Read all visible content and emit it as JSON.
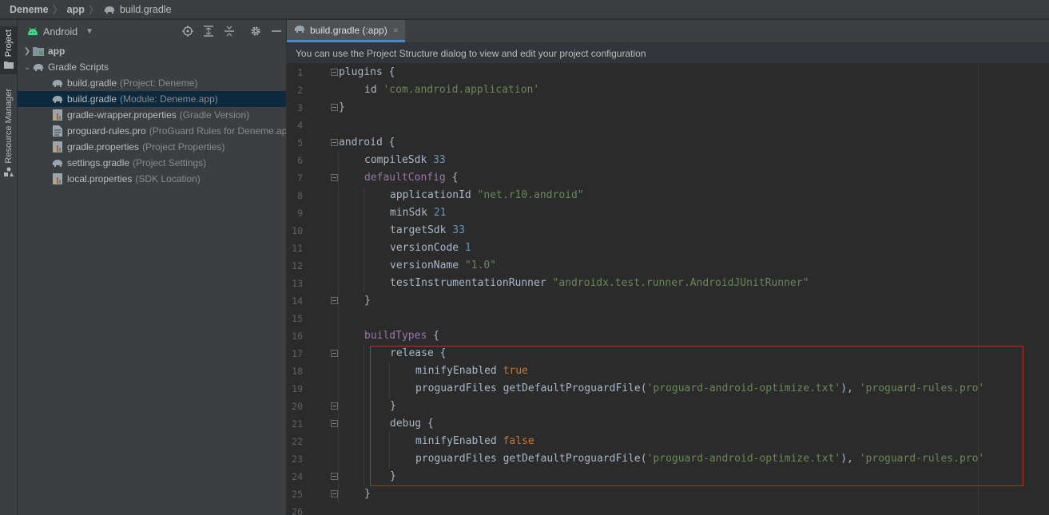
{
  "breadcrumb": {
    "items": [
      "Deneme",
      "app",
      "build.gradle"
    ],
    "separator": "〉"
  },
  "tool_strip": {
    "project": "Project",
    "resource_manager": "Resource Manager"
  },
  "project_panel": {
    "view_mode": "Android",
    "tree": [
      {
        "label": "app",
        "desc": ""
      },
      {
        "label": "Gradle Scripts",
        "desc": ""
      },
      {
        "label": "build.gradle",
        "desc": "(Project: Deneme)"
      },
      {
        "label": "build.gradle",
        "desc": "(Module: Deneme.app)"
      },
      {
        "label": "gradle-wrapper.properties",
        "desc": "(Gradle Version)"
      },
      {
        "label": "proguard-rules.pro",
        "desc": "(ProGuard Rules for Deneme.app)"
      },
      {
        "label": "gradle.properties",
        "desc": "(Project Properties)"
      },
      {
        "label": "settings.gradle",
        "desc": "(Project Settings)"
      },
      {
        "label": "local.properties",
        "desc": "(SDK Location)"
      }
    ]
  },
  "editor": {
    "tab_label": "build.gradle (:app)",
    "tab_close": "×",
    "notice": "You can use the Project Structure dialog to view and edit your project configuration",
    "line_numbers": [
      "1",
      "2",
      "3",
      "4",
      "5",
      "6",
      "7",
      "8",
      "9",
      "10",
      "11",
      "12",
      "13",
      "14",
      "15",
      "16",
      "17",
      "18",
      "19",
      "20",
      "21",
      "22",
      "23",
      "24",
      "25",
      "26"
    ],
    "code": {
      "l1": {
        "a": "plugins {"
      },
      "l2": {
        "a": "id ",
        "b": "'com.android.application'"
      },
      "l3": {
        "a": "}"
      },
      "l5": {
        "a": "android {"
      },
      "l6": {
        "a": "compileSdk ",
        "b": "33"
      },
      "l7": {
        "a": "defaultConfig",
        "b": " {"
      },
      "l8": {
        "a": "applicationId ",
        "b": "\"net.r10.android\""
      },
      "l9": {
        "a": "minSdk ",
        "b": "21"
      },
      "l10": {
        "a": "targetSdk ",
        "b": "33"
      },
      "l11": {
        "a": "versionCode ",
        "b": "1"
      },
      "l12": {
        "a": "versionName ",
        "b": "\"1.0\""
      },
      "l13": {
        "a": "testInstrumentationRunner ",
        "b": "\"androidx.test.runner.AndroidJUnitRunner\""
      },
      "l14": {
        "a": "}"
      },
      "l16": {
        "a": "buildTypes",
        "b": " {"
      },
      "l17": {
        "a": "release {"
      },
      "l18": {
        "a": "minifyEnabled ",
        "b": "true"
      },
      "l19": {
        "a": "proguardFiles getDefaultProguardFile(",
        "b": "'proguard-android-optimize.txt'",
        "c": "), ",
        "d": "'proguard-rules.pro'"
      },
      "l20": {
        "a": "}"
      },
      "l21": {
        "a": "debug {"
      },
      "l22": {
        "a": "minifyEnabled ",
        "b": "false"
      },
      "l23": {
        "a": "proguardFiles getDefaultProguardFile(",
        "b": "'proguard-android-optimize.txt'",
        "c": "), ",
        "d": "'proguard-rules.pro'"
      },
      "l24": {
        "a": "}"
      },
      "l25": {
        "a": "}"
      }
    }
  },
  "colors": {
    "keyword": "#cc7832",
    "string": "#6a8759",
    "number": "#6897bb",
    "purple": "#9876aa",
    "highlight_box": "#d0262b",
    "selection": "#0d293e"
  },
  "icons": [
    "gradle-elephant-icon",
    "android-icon",
    "folder-icon",
    "properties-file-icon",
    "text-file-icon",
    "locate-icon",
    "expand-all-icon",
    "collapse-all-icon",
    "gear-icon",
    "minimize-icon"
  ]
}
